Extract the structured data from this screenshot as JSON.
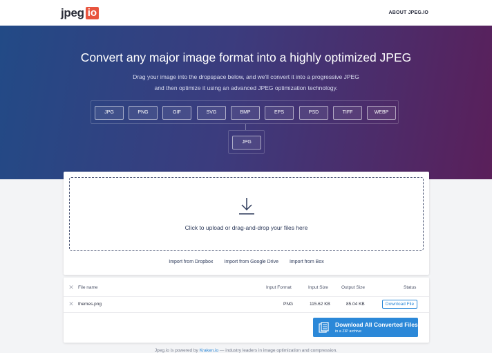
{
  "header": {
    "logo_text": "jpeg",
    "logo_badge": "io",
    "about_label": "ABOUT JPEG.IO"
  },
  "hero": {
    "title": "Convert any major image format into a highly optimized JPEG",
    "desc_line1": "Drag your image into the dropspace below, and we'll convert it into a progressive JPEG",
    "desc_line2": "and then optimize it using an advanced JPEG optimization technology.",
    "input_formats": [
      "JPG",
      "PNG",
      "GIF",
      "SVG",
      "BMP",
      "EPS",
      "PSD",
      "TIFF",
      "WEBP"
    ],
    "output_format": "JPG"
  },
  "upload": {
    "drop_text": "Click to upload or drag-and-drop your files here",
    "import_dropbox": "Import from Dropbox",
    "import_gdrive": "Import from Google Drive",
    "import_box": "Import from Box"
  },
  "files": {
    "columns": {
      "file_name": "File name",
      "input_format": "Input Format",
      "input_size": "Input Size",
      "output_size": "Output Size",
      "status": "Status"
    },
    "rows": [
      {
        "file_name": "themes.png",
        "input_format": "PNG",
        "input_size": "115.62 KB",
        "output_size": "85.04 KB",
        "status_button": "Download File"
      }
    ],
    "zip_title": "Download All Converted Files",
    "zip_subtitle": "in a ZIP archive"
  },
  "footer": {
    "text_before": "Jpeg.io is powered by",
    "link": "Kraken.io",
    "text_after": "— industry leaders in image optimization and compression."
  },
  "colors": {
    "accent_blue": "#2b88d8",
    "logo_red": "#e8543e",
    "hero_start": "#224a86",
    "hero_end": "#5a1f5a"
  }
}
